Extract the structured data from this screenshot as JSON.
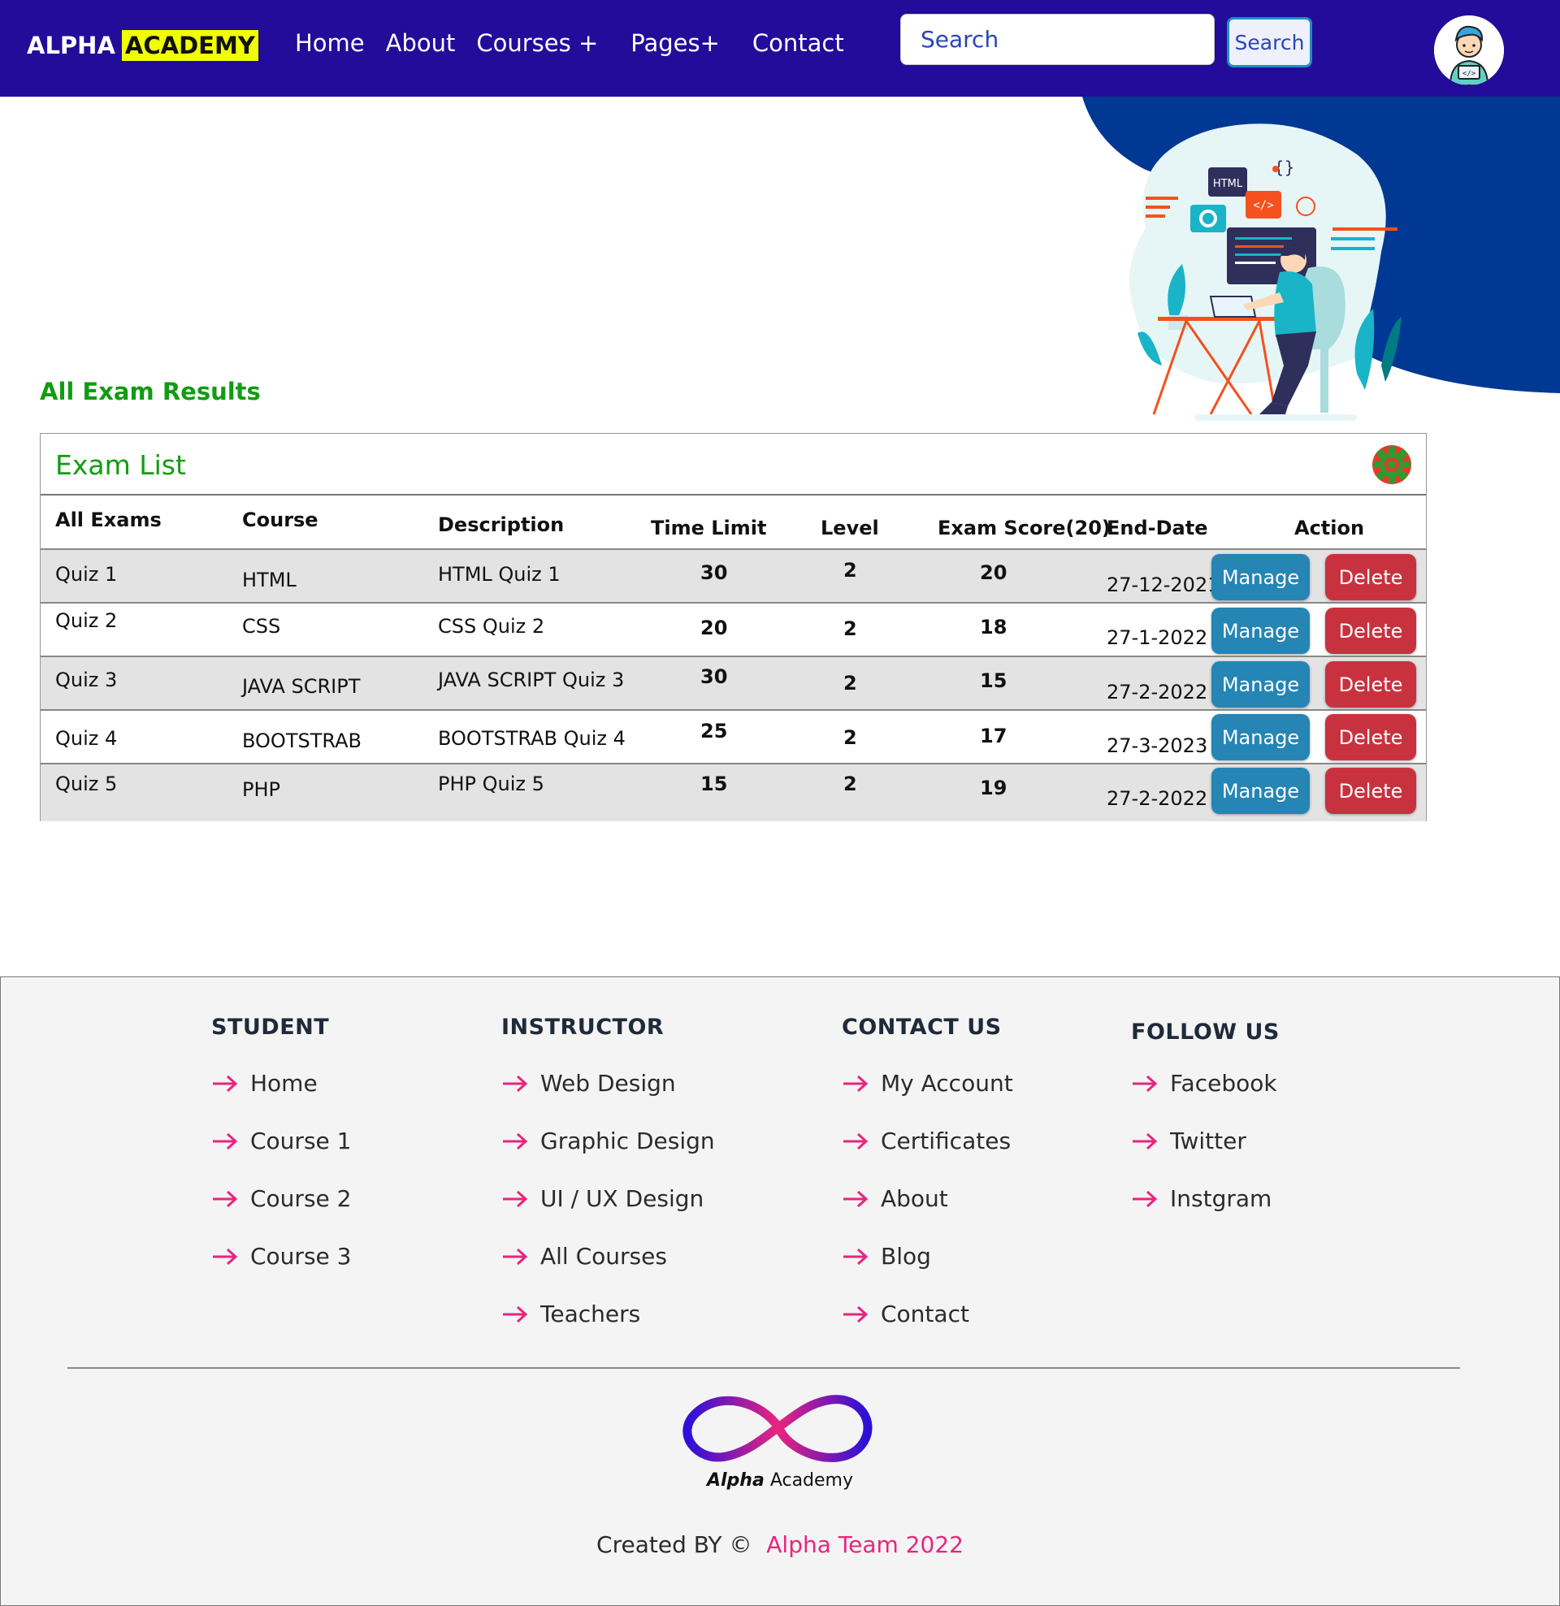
{
  "brand": {
    "name_part1": "ALPHA",
    "name_part2": "ACADEMY"
  },
  "nav": {
    "home": "Home",
    "about": "About",
    "courses": "Courses +",
    "pages": "Pages+",
    "contact": "Contact"
  },
  "search": {
    "placeholder": "Search",
    "button_label": "Search"
  },
  "section_title": "All Exam Results",
  "exam_list": {
    "title": "Exam List",
    "columns": [
      "All Exams",
      "Course",
      "Description",
      "Time Limit",
      "Level",
      "Exam Score(20)",
      "End-Date",
      "Action"
    ],
    "rows": [
      {
        "exam": "Quiz 1",
        "course": "HTML",
        "description": "HTML Quiz 1",
        "time_limit": "30",
        "level": "2",
        "score": "20",
        "end_date": "27-12-2021"
      },
      {
        "exam": "Quiz 2",
        "course": "CSS",
        "description": "CSS Quiz 2",
        "time_limit": "20",
        "level": "2",
        "score": "18",
        "end_date": "27-1-2022"
      },
      {
        "exam": "Quiz 3",
        "course": "JAVA SCRIPT",
        "description": "JAVA SCRIPT Quiz 3",
        "time_limit": "30",
        "level": "2",
        "score": "15",
        "end_date": "27-2-2022"
      },
      {
        "exam": "Quiz 4",
        "course": "BOOTSTRAB",
        "description": "BOOTSTRAB Quiz 4",
        "time_limit": "25",
        "level": "2",
        "score": "17",
        "end_date": "27-3-2023"
      },
      {
        "exam": "Quiz 5",
        "course": "PHP",
        "description": "PHP Quiz 5",
        "time_limit": "15",
        "level": "2",
        "score": "19",
        "end_date": "27-2-2022"
      }
    ],
    "manage_label": "Manage",
    "delete_label": "Delete"
  },
  "hero_illustration": {
    "badge_text": "HTML"
  },
  "footer": {
    "student": {
      "heading": "STUDENT",
      "items": [
        "Home",
        "Course 1",
        "Course 2",
        "Course 3"
      ]
    },
    "instructor": {
      "heading": "INSTRUCTOR",
      "items": [
        "Web Design",
        "Graphic Design",
        "UI / UX Design",
        "All Courses",
        "Teachers"
      ]
    },
    "contact": {
      "heading": "CONTACT US",
      "items": [
        "My Account",
        "Certificates",
        "About",
        "Blog",
        "Contact"
      ]
    },
    "follow": {
      "heading": "FOLLOW US",
      "items": [
        "Facebook",
        "Twitter",
        "Instgram"
      ]
    },
    "logo_text_italic": "Alpha",
    "logo_text": "Academy",
    "credit_prefix": "Created BY ©",
    "credit_team": "Alpha Team 2022"
  },
  "colors": {
    "navbar": "#230c9a",
    "brand_highlight": "#f1ff00",
    "section_green": "#129c12",
    "manage_blue": "#2585b5",
    "delete_red": "#c8323f",
    "footer_accent_pink": "#e8257e",
    "hero_blob": "#003894"
  },
  "icons": [
    "user-avatar-icon",
    "gear-icon",
    "arrow-right-icon",
    "infinity-logo"
  ]
}
